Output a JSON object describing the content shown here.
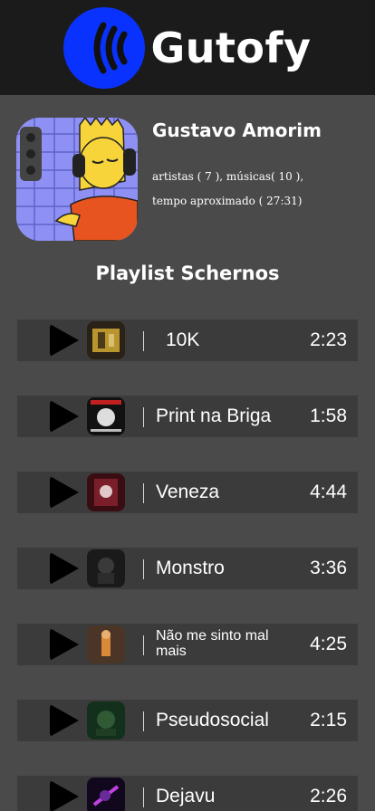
{
  "app": {
    "title": "Gutofy",
    "logo_icon": "sound-waves-icon",
    "brand_color": "#0a32ff"
  },
  "profile": {
    "name": "Gustavo Amorim",
    "stats_line1": "artistas ( 7 ), músicas( 10 ),",
    "stats_line2": "tempo aproximado ( 27:31)",
    "avatar_icon": "cartoon-avatar-icon"
  },
  "playlist": {
    "title": "Playlist Schernos",
    "tracks": [
      {
        "title": "10K",
        "duration": "2:23",
        "cover_icon": "album-cover-icon"
      },
      {
        "title": "Print na Briga",
        "duration": "1:58",
        "cover_icon": "album-cover-icon"
      },
      {
        "title": "Veneza",
        "duration": "4:44",
        "cover_icon": "album-cover-icon"
      },
      {
        "title": "Monstro",
        "duration": "3:36",
        "cover_icon": "album-cover-icon"
      },
      {
        "title": "Não me sinto mal mais",
        "duration": "4:25",
        "cover_icon": "album-cover-icon"
      },
      {
        "title": "Pseudosocial",
        "duration": "2:15",
        "cover_icon": "album-cover-icon"
      },
      {
        "title": "Dejavu",
        "duration": "2:26",
        "cover_icon": "album-cover-icon"
      }
    ]
  }
}
